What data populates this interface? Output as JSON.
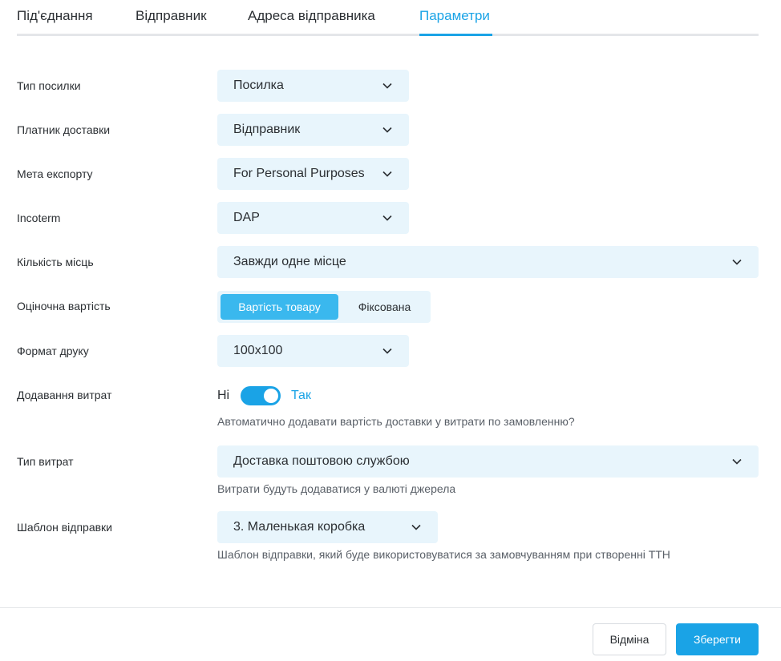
{
  "tabs": [
    {
      "label": "Під'єднання",
      "active": false
    },
    {
      "label": "Відправник",
      "active": false
    },
    {
      "label": "Адреса відправника",
      "active": false
    },
    {
      "label": "Параметри",
      "active": true
    }
  ],
  "form": {
    "parcel_type": {
      "label": "Тип посилки",
      "value": "Посилка"
    },
    "delivery_payer": {
      "label": "Платник доставки",
      "value": "Відправник"
    },
    "export_purpose": {
      "label": "Мета експорту",
      "value": "For Personal Purposes"
    },
    "incoterm": {
      "label": "Incoterm",
      "value": "DAP"
    },
    "places_count": {
      "label": "Кількість місць",
      "value": "Завжди одне місце"
    },
    "declared_value": {
      "label": "Оціночна вартість",
      "options": [
        "Вартість товару",
        "Фіксована"
      ],
      "selected": "Вартість товару"
    },
    "print_format": {
      "label": "Формат друку",
      "value": "100x100"
    },
    "add_expenses": {
      "label": "Додавання витрат",
      "off_label": "Ні",
      "on_label": "Так",
      "enabled": true,
      "hint": "Автоматично додавати вартість доставки у витрати по замовленню?"
    },
    "expense_type": {
      "label": "Тип витрат",
      "value": "Доставка поштовою службою",
      "hint": "Витрати будуть додаватися у валюті джерела"
    },
    "shipment_template": {
      "label": "Шаблон відправки",
      "value": "3. Маленькая коробка",
      "hint": "Шаблон відправки, який буде використовуватися за замовчуванням при створенні ТТН"
    }
  },
  "footer": {
    "cancel_label": "Відміна",
    "save_label": "Зберегти"
  },
  "colors": {
    "accent": "#1aa3e6",
    "field_bg": "#e8f5fc",
    "segment_active": "#3ab8ee"
  },
  "icons": {
    "select_arrow": "chevron-down-icon"
  }
}
